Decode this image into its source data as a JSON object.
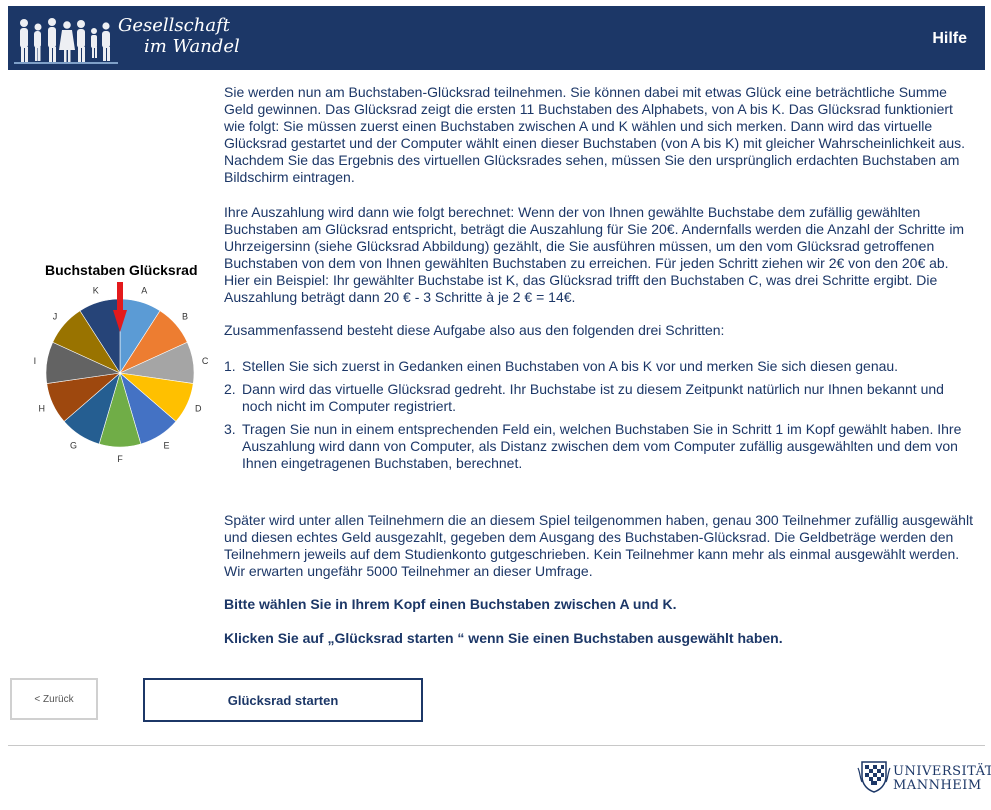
{
  "header": {
    "logo_line1": "Gesellschaft",
    "logo_line2": "im Wandel",
    "help_label": "Hilfe"
  },
  "wheel": {
    "title": "Buchstaben Glücksrad",
    "letters": [
      "A",
      "B",
      "C",
      "D",
      "E",
      "F",
      "G",
      "H",
      "I",
      "J",
      "K"
    ],
    "segment_colors": [
      "#5b9bd5",
      "#ed7d31",
      "#a5a5a5",
      "#ffc000",
      "#4472c4",
      "#70ad47",
      "#255e91",
      "#9e480e",
      "#636363",
      "#997300",
      "#264478"
    ],
    "arrow_color": "#e31a1c"
  },
  "content": {
    "paragraph1": "Sie werden nun am Buchstaben-Glücksrad teilnehmen. Sie können dabei mit etwas Glück eine beträchtliche Summe Geld gewinnen. Das Glücksrad zeigt die ersten 11 Buchstaben des Alphabets, von A bis K. Das Glücksrad funktioniert wie folgt: Sie müssen zuerst einen Buchstaben zwischen A und K wählen und sich merken. Dann wird das virtuelle Glücksrad gestartet und der Computer wählt einen dieser Buchstaben (von A bis K) mit gleicher Wahrscheinlichkeit aus. Nachdem Sie das Ergebnis des virtuellen Glücksrades sehen, müssen Sie den ursprünglich erdachten Buchstaben am Bildschirm eintragen.",
    "paragraph2": "Ihre Auszahlung wird dann wie folgt berechnet: Wenn der von Ihnen gewählte Buchstabe dem zufällig gewählten Buchstaben am Glücksrad entspricht, beträgt die Auszahlung für Sie 20€. Andernfalls werden die Anzahl der Schritte im Uhrzeigersinn (siehe Glücksrad Abbildung) gezählt, die Sie ausführen müssen, um den vom Glücksrad getroffenen Buchstaben von dem von Ihnen gewählten Buchstaben zu erreichen. Für jeden Schritt ziehen wir 2€ von den 20€ ab. Hier ein Beispiel: Ihr gewählter Buchstabe ist K, das Glücksrad trifft den Buchstaben C, was drei Schritte ergibt. Die Auszahlung beträgt dann 20 € - 3 Schritte à je 2 € = 14€.",
    "paragraph3": "Zusammenfassend besteht diese Aufgabe also aus den folgenden drei Schritten:",
    "steps": [
      {
        "num": "1.",
        "text": "Stellen Sie sich zuerst in Gedanken einen Buchstaben von A bis K vor und merken Sie sich diesen genau."
      },
      {
        "num": "2.",
        "text": "Dann wird das virtuelle Glücksrad gedreht. Ihr Buchstabe ist zu diesem Zeitpunkt natürlich nur Ihnen bekannt und noch nicht im Computer registriert."
      },
      {
        "num": "3.",
        "text": "Tragen Sie nun in einem entsprechenden Feld ein, welchen Buchstaben Sie in Schritt 1 im Kopf gewählt haben. Ihre Auszahlung wird dann von Computer, als Distanz zwischen dem vom Computer zufällig ausgewählten und dem von Ihnen eingetragenen Buchstaben, berechnet."
      }
    ],
    "paragraph4": "Später wird unter allen Teilnehmern die an diesem Spiel teilgenommen haben, genau 300 Teilnehmer zufällig ausgewählt und diesen echtes Geld ausgezahlt, gegeben dem Ausgang des Buchstaben-Glücksrad. Die Geldbeträge werden den Teilnehmern jeweils auf dem Studienkonto gutgeschrieben. Kein Teilnehmer kann mehr als einmal ausgewählt werden. Wir erwarten ungefähr 5000 Teilnehmer an dieser Umfrage.",
    "instruction1": "Bitte wählen Sie in Ihrem Kopf einen Buchstaben zwischen A und K.",
    "instruction2": "Klicken Sie auf „Glücksrad starten “ wenn Sie einen Buchstaben ausgewählt haben."
  },
  "buttons": {
    "back_label": "< Zurück",
    "start_label": "Glücksrad starten"
  },
  "footer": {
    "uni_line1": "UNIVERSITÄT",
    "uni_line2": "MANNHEIM"
  }
}
